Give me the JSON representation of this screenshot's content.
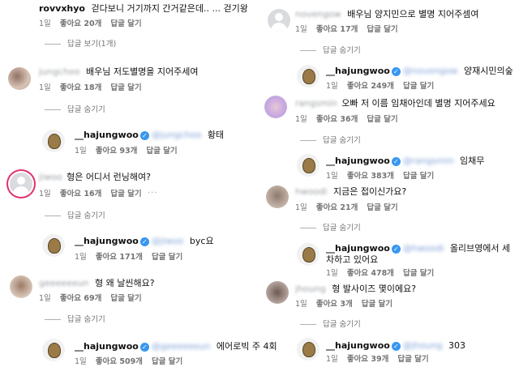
{
  "left": [
    {
      "user": "rovvxhyo",
      "verified": false,
      "mention": "",
      "text": "걷다보니 거기까지 간거같은데.. ... 걷기왕",
      "time": "1일",
      "likes": "좋아요 20개",
      "reply": "답글 달기",
      "replies": "답글 보기(1개)"
    },
    {
      "user": "jungchoo",
      "verified": false,
      "mention": "",
      "text": "배우님 저도별명을 지어주세여",
      "time": "1일",
      "likes": "좋아요 18개",
      "reply": "답글 달기",
      "replies": "답글 숨기기"
    },
    {
      "user": "__hajungwoo",
      "verified": true,
      "mention": "@jungchoo",
      "text": "황태",
      "time": "1일",
      "likes": "좋아요 93개",
      "reply": "답글 달기",
      "replies": ""
    },
    {
      "user": "jiwoo",
      "verified": false,
      "mention": "",
      "text": "형은 어디서 런닝해여?",
      "time": "1일",
      "likes": "좋아요 16개",
      "reply": "답글 달기",
      "replies": "답글 숨기기"
    },
    {
      "user": "__hajungwoo",
      "verified": true,
      "mention": "@jiwoo",
      "text": "byc요",
      "time": "1일",
      "likes": "좋아요 171개",
      "reply": "답글 달기",
      "replies": ""
    },
    {
      "user": "geeeeeeun",
      "verified": false,
      "mention": "",
      "text": "형 왜 날씬해요?",
      "time": "1일",
      "likes": "좋아요 69개",
      "reply": "답글 달기",
      "replies": "답글 숨기기"
    },
    {
      "user": "__hajungwoo",
      "verified": true,
      "mention": "@geeeeeeun",
      "text": "에어로빅 주 4회",
      "time": "1일",
      "likes": "좋아요 509개",
      "reply": "답글 달기",
      "replies": ""
    }
  ],
  "right": [
    {
      "user": "novengow",
      "verified": false,
      "mention": "",
      "text": "배우님 양지민으로 별명 지어주셈여",
      "time": "1일",
      "likes": "좋아요 17개",
      "reply": "답글 달기",
      "replies": "답글 숨기기"
    },
    {
      "user": "__hajungwoo",
      "verified": true,
      "mention": "@novengow",
      "text": "양재시민의숲",
      "time": "1일",
      "likes": "좋아요 249개",
      "reply": "답글 달기",
      "replies": ""
    },
    {
      "user": "rangsmin",
      "verified": false,
      "mention": "",
      "text": "오빠 저 이름 임채아인데 별명 지어주세요",
      "time": "1일",
      "likes": "좋아요 36개",
      "reply": "답글 달기",
      "replies": "답글 숨기기"
    },
    {
      "user": "__hajungwoo",
      "verified": true,
      "mention": "@rangsmin",
      "text": "임채무",
      "time": "1일",
      "likes": "좋아요 383개",
      "reply": "답글 달기",
      "replies": ""
    },
    {
      "user": "hwoodi",
      "verified": false,
      "mention": "",
      "text": "지금은 접이신가요?",
      "time": "1일",
      "likes": "좋아요 21개",
      "reply": "답글 달기",
      "replies": "답글 숨기기"
    },
    {
      "user": "__hajungwoo",
      "verified": true,
      "mention": "@hwoodi",
      "text": "올리브영에서 세차하고 있어요",
      "time": "1일",
      "likes": "좋아요 478개",
      "reply": "답글 달기",
      "replies": ""
    },
    {
      "user": "jhoung",
      "verified": false,
      "mention": "",
      "text": "형 발사이즈 몇이에요?",
      "time": "1일",
      "likes": "좋아요 3개",
      "reply": "답글 달기",
      "replies": "답글 숨기기"
    },
    {
      "user": "__hajungwoo",
      "verified": true,
      "mention": "@jhoung",
      "text": "303",
      "time": "1일",
      "likes": "좋아요 39개",
      "reply": "답글 달기",
      "replies": ""
    }
  ]
}
